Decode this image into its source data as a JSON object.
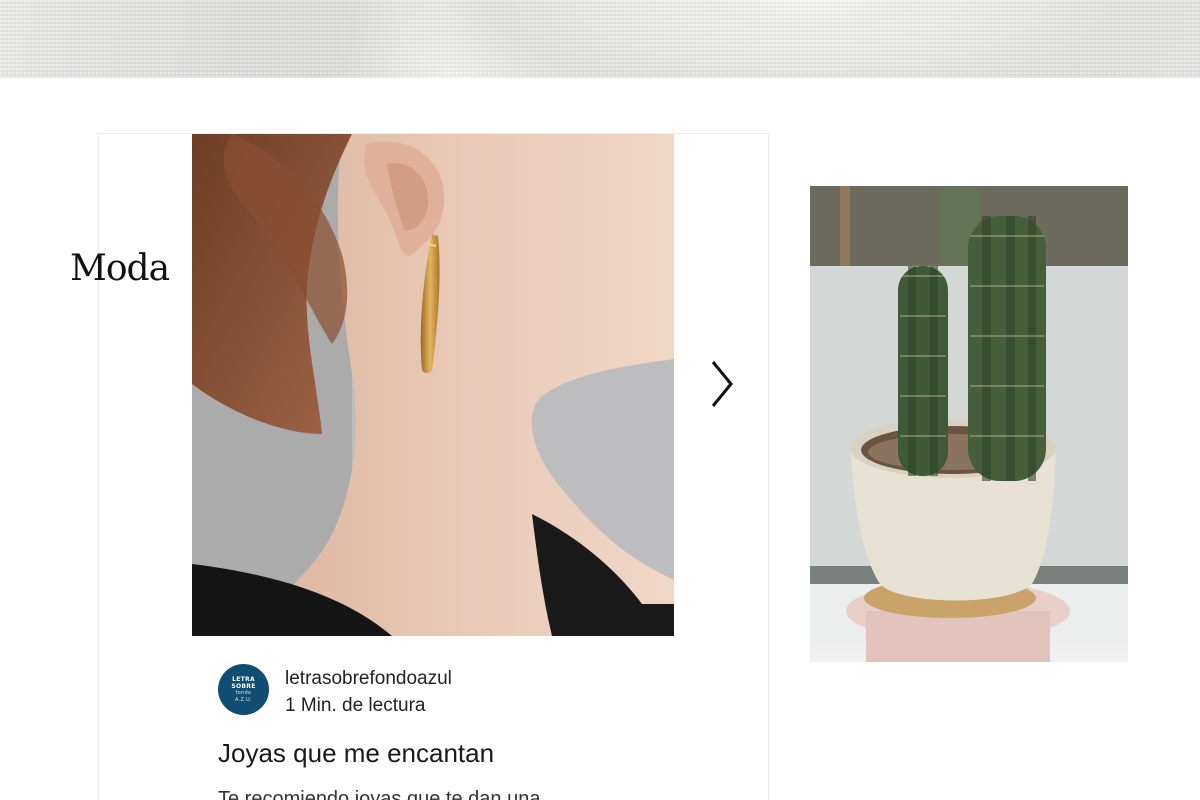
{
  "category": {
    "label": "Moda"
  },
  "post": {
    "author": "letrasobrefondoazul",
    "read_time": "1 Min. de lectura",
    "title": "Joyas que me encantan",
    "excerpt": "Te recomiendo joyas que te dan una",
    "avatar_text": [
      "LETRA",
      "SOBRE",
      "fondo",
      "A.Z.U."
    ]
  },
  "icons": {
    "next": "chevron-right-icon"
  },
  "colors": {
    "avatar_bg": "#0f4e72",
    "text": "#1a1a1a"
  }
}
